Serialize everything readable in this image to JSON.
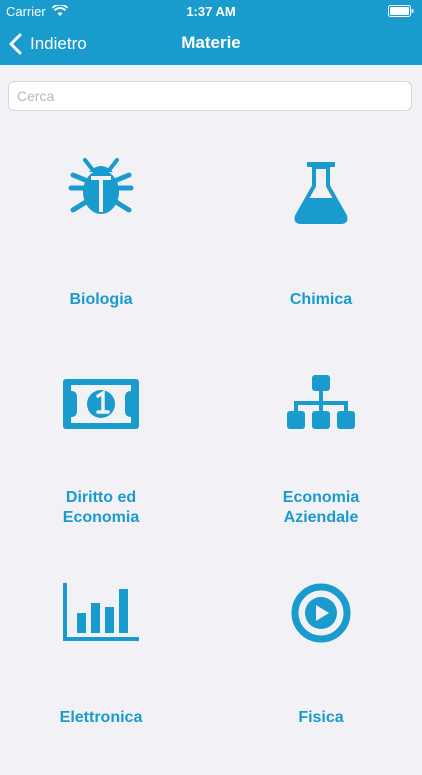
{
  "status_bar": {
    "carrier": "Carrier",
    "time": "1:37 AM",
    "icons": [
      "wifi-icon",
      "battery-icon"
    ]
  },
  "nav": {
    "back_label": "Indietro",
    "title": "Materie"
  },
  "search": {
    "placeholder": "Cerca",
    "value": ""
  },
  "subjects": [
    {
      "label_line1": "Biologia",
      "label_line2": "",
      "icon": "bug-icon"
    },
    {
      "label_line1": "Chimica",
      "label_line2": "",
      "icon": "flask-icon"
    },
    {
      "label_line1": "Diritto ed",
      "label_line2": "Economia",
      "icon": "banknote-icon"
    },
    {
      "label_line1": "Economia",
      "label_line2": "Aziendale",
      "icon": "hierarchy-icon"
    },
    {
      "label_line1": "Elettronica",
      "label_line2": "",
      "icon": "bar-chart-icon"
    },
    {
      "label_line1": "Fisica",
      "label_line2": "",
      "icon": "play-circle-icon"
    }
  ],
  "colors": {
    "accent": "#199bcd",
    "background": "#f2f1f6",
    "header_text": "#ffffff"
  }
}
